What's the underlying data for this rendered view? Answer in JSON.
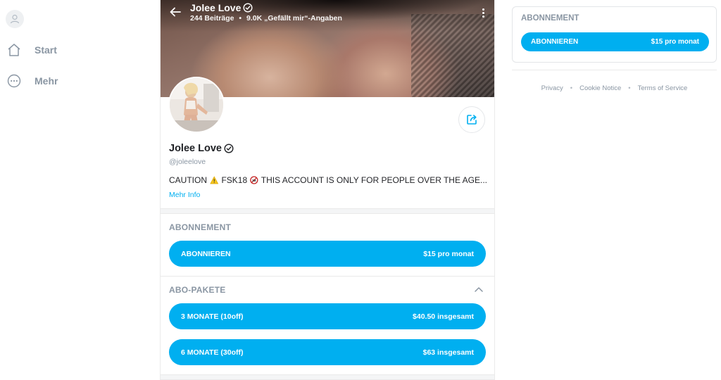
{
  "nav": {
    "items": [
      {
        "label": "Start",
        "icon": "home-icon"
      },
      {
        "label": "Mehr",
        "icon": "more-circle-icon"
      }
    ]
  },
  "header": {
    "name": "Jolee Love",
    "posts": "244 Beiträge",
    "separator": "•",
    "likes": "9.0K „Gefällt mir“-Angaben"
  },
  "profile": {
    "name": "Jolee Love",
    "handle": "@joleelove",
    "bio_prefix": "CAUTION",
    "bio_mid": "FSK18",
    "bio_rest": "THIS ACCOUNT IS ONLY FOR PEOPLE OVER THE AGE...",
    "more_info": "Mehr Info"
  },
  "subscription": {
    "title": "ABONNEMENT",
    "button_label": "ABONNIEREN",
    "button_price": "$15 pro monat"
  },
  "bundles": {
    "title": "ABO-PAKETE",
    "items": [
      {
        "label": "3 MONATE (10off)",
        "price": "$40.50 insgesamt"
      },
      {
        "label": "6 MONATE (30off)",
        "price": "$63 insgesamt"
      }
    ]
  },
  "sidebar_card": {
    "title": "ABONNEMENT",
    "button_label": "ABONNIEREN",
    "button_price": "$15 pro monat"
  },
  "footer": {
    "links": [
      "Privacy",
      "Cookie Notice",
      "Terms of Service"
    ],
    "separator": "•"
  },
  "colors": {
    "accent": "#00aff0",
    "muted": "#8a96a3"
  }
}
